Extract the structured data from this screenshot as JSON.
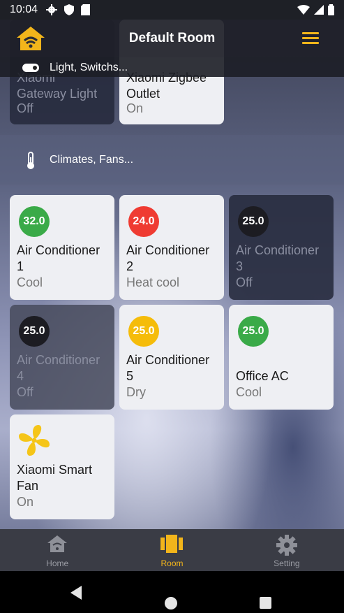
{
  "status_bar": {
    "time": "10:04"
  },
  "app_bar": {
    "title": "Default Room"
  },
  "sections": {
    "lights_label": "Light, Switchs...",
    "climates_label": "Climates, Fans..."
  },
  "light_cards": [
    {
      "name": "Xiaomi Gateway Light",
      "name_line1": "Xiaomi",
      "name_line2": "Gateway Light",
      "state": "Off"
    },
    {
      "name": "Xiaomi Zigbee Outlet",
      "name_line1": "Xiaomi Zigbee",
      "name_line2": "Outlet",
      "state": "On"
    }
  ],
  "climate_cards": [
    {
      "temp": "32.0",
      "line1": "Air Conditioner",
      "line2": "1",
      "state": "Cool",
      "badge_color": "#3aaa48"
    },
    {
      "temp": "24.0",
      "line1": "Air Conditioner",
      "line2": "2",
      "state": "Heat cool",
      "badge_color": "#ef3b32"
    },
    {
      "temp": "25.0",
      "line1": "Air Conditioner",
      "line2": "3",
      "state": "Off",
      "badge_color": "#1c1c22"
    },
    {
      "temp": "25.0",
      "line1": "Air Conditioner",
      "line2": "4",
      "state": "Off",
      "badge_color": "#1c1c22"
    },
    {
      "temp": "25.0",
      "line1": "Air Conditioner",
      "line2": "5",
      "state": "Dry",
      "badge_color": "#f5bc0a"
    },
    {
      "temp": "25.0",
      "line1": "Office AC",
      "state": "Cool",
      "badge_color": "#3aaa48"
    },
    {
      "line1": "Xiaomi Smart",
      "line2": "Fan",
      "state": "On",
      "icon": "fan-icon"
    }
  ],
  "bottom_nav": [
    {
      "label": "Home",
      "icon": "home-icon"
    },
    {
      "label": "Room",
      "icon": "room-icon",
      "active": true
    },
    {
      "label": "Setting",
      "icon": "gear-icon"
    }
  ],
  "colors": {
    "accent": "#f2b51b"
  }
}
